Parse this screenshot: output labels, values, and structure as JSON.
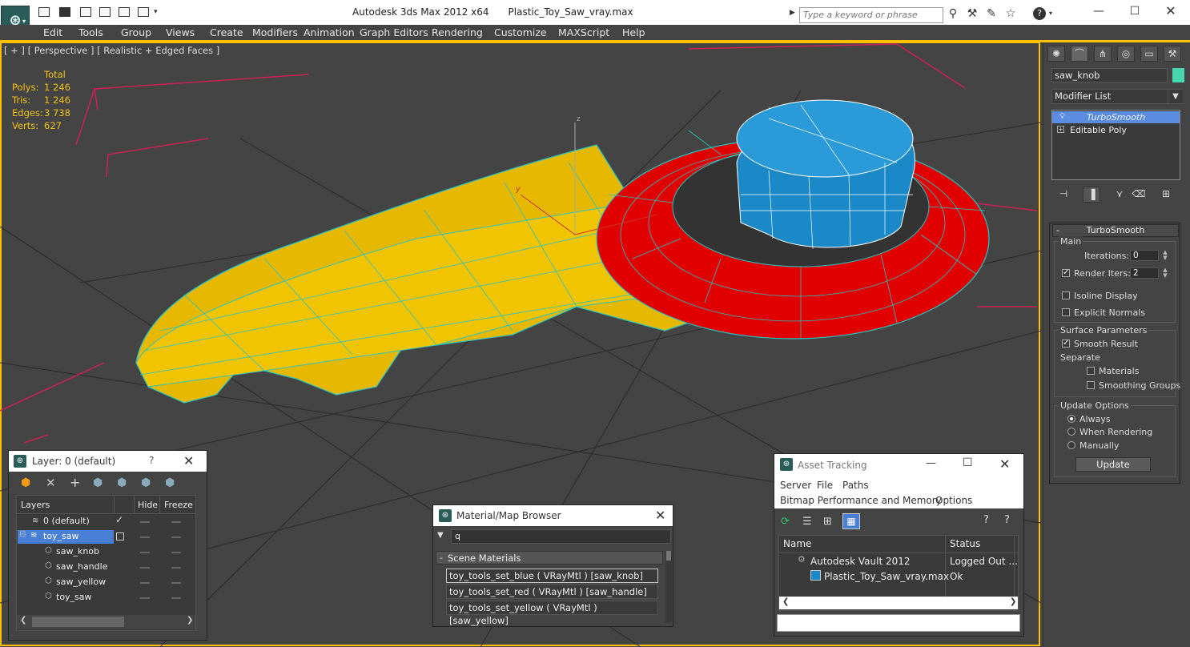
{
  "app": {
    "title": "Autodesk 3ds Max  2012 x64",
    "file": "Plastic_Toy_Saw_vray.max",
    "search_placeholder": "Type a keyword or phrase"
  },
  "menu": [
    "Edit",
    "Tools",
    "Group",
    "Views",
    "Create",
    "Modifiers",
    "Animation",
    "Graph Editors",
    "Rendering",
    "Customize",
    "MAXScript",
    "Help"
  ],
  "viewport": {
    "label": "[ + ] [ Perspective ] [ Realistic + Edged Faces ]",
    "stats": {
      "header": "Total",
      "rows": [
        {
          "k": "Polys:",
          "v": "1 246"
        },
        {
          "k": "Tris:",
          "v": "1 246"
        },
        {
          "k": "Edges:",
          "v": "3 738"
        },
        {
          "k": "Verts:",
          "v": "627"
        }
      ]
    },
    "axis": {
      "z": "z",
      "y": "y"
    },
    "colors": {
      "yellow": "#e6b800",
      "red": "#e00000",
      "blue": "#1b88c8",
      "wire": "#27c5c5",
      "grid": "#cc2255"
    }
  },
  "command_panel": {
    "object_name": "saw_knob",
    "object_color": "#48d6b0",
    "modifier_list": "Modifier List",
    "stack": [
      "TurboSmooth",
      "Editable Poly"
    ],
    "rollout_title": "TurboSmooth",
    "main": {
      "title": "Main",
      "iterations_label": "Iterations:",
      "iterations": "0",
      "render_iters_label": "Render Iters:",
      "render_iters": "2",
      "isoline": "Isoline Display",
      "explicit_normals": "Explicit Normals"
    },
    "surface": {
      "title": "Surface Parameters",
      "smooth_result": "Smooth Result",
      "separate": "Separate",
      "materials": "Materials",
      "smoothing_groups": "Smoothing Groups"
    },
    "update": {
      "title": "Update Options",
      "always": "Always",
      "when_rendering": "When Rendering",
      "manually": "Manually",
      "button": "Update"
    }
  },
  "layer_window": {
    "title": "Layer: 0 (default)",
    "help": "?",
    "columns": [
      "Layers",
      "Hide",
      "Freeze"
    ],
    "rows": [
      {
        "name": "0 (default)"
      },
      {
        "name": "toy_saw"
      },
      {
        "name": "saw_knob"
      },
      {
        "name": "saw_handle"
      },
      {
        "name": "saw_yellow"
      },
      {
        "name": "toy_saw"
      }
    ]
  },
  "material_browser": {
    "title": "Material/Map Browser",
    "search": "q",
    "group": "Scene Materials",
    "items": [
      "toy_tools_set_blue  ( VRayMtl ) [saw_knob]",
      "toy_tools_set_red  ( VRayMtl ) [saw_handle]",
      "toy_tools_set_yellow  ( VRayMtl ) [saw_yellow]"
    ]
  },
  "asset_tracking": {
    "title": "Asset Tracking",
    "menu1": [
      "Server",
      "File",
      "Paths"
    ],
    "menu2": [
      "Bitmap Performance and Memory",
      "Options"
    ],
    "columns": [
      "Name",
      "Status"
    ],
    "rows": [
      {
        "name": "Autodesk Vault 2012",
        "status": "Logged Out ..."
      },
      {
        "name": "Plastic_Toy_Saw_vray.max",
        "status": "Ok"
      }
    ]
  }
}
